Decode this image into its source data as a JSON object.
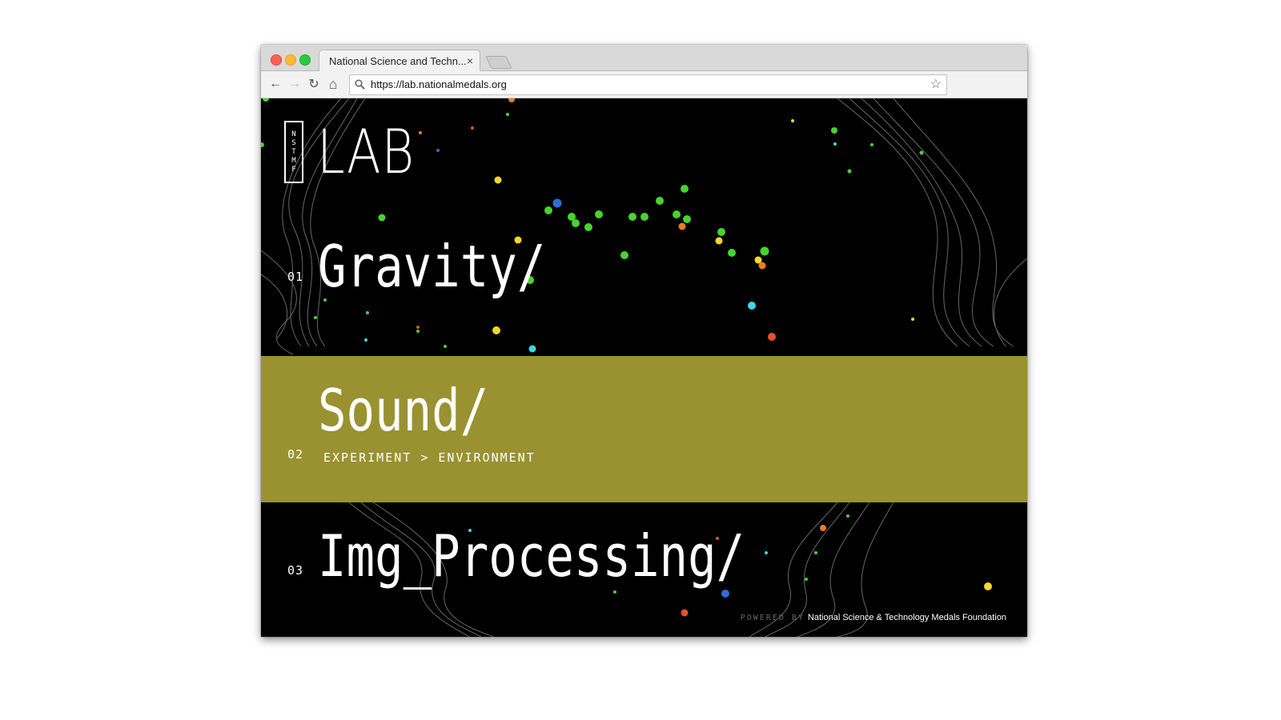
{
  "browser": {
    "tab_title": "National Science and Techn...",
    "tab_close": "×",
    "url": "https://lab.nationalmedals.org",
    "star": "☆",
    "back": "←",
    "forward": "→",
    "reload": "↻",
    "home": "⌂"
  },
  "site": {
    "logo_letters": [
      "N",
      "S",
      "T",
      "M",
      "F"
    ],
    "title": "LAB"
  },
  "menu": {
    "items": [
      {
        "num": "01",
        "title": "Gravity/"
      },
      {
        "num": "02",
        "title": "Sound/",
        "subtitle": "EXPERIMENT > ENVIRONMENT"
      },
      {
        "num": "03",
        "title": "Img_Processing/"
      }
    ]
  },
  "footer": {
    "powered": "POWERED BY",
    "org": "National Science & Technology Medals Foundation"
  },
  "colors": {
    "page_background": "#000000",
    "active_band": "#9a9130",
    "dot_colors": [
      "#47d42f",
      "#f2d72c",
      "#e8502a",
      "#2e6fd6",
      "#3ed8e8",
      "#ef7d22"
    ]
  },
  "icons": [
    "back-arrow-icon",
    "forward-arrow-icon",
    "reload-icon",
    "home-icon",
    "search-icon",
    "star-icon",
    "close-icon"
  ]
}
